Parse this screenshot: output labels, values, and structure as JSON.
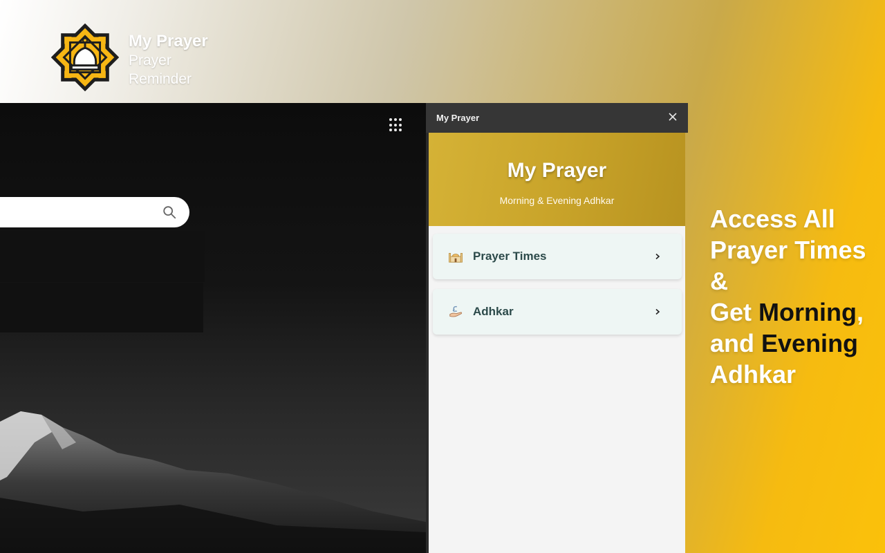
{
  "brand": {
    "title": "My Prayer",
    "subtitle_line1": "Prayer",
    "subtitle_line2": "Reminder",
    "logo_icon": "mosque-star-icon"
  },
  "browser": {
    "apps_icon": "apps-grid-icon",
    "search_icon": "search-icon",
    "search_placeholder": ""
  },
  "panel": {
    "bar_title": "My Prayer",
    "close_icon": "close-icon",
    "hero_title": "My Prayer",
    "hero_subtitle": "Morning & Evening Adhkar",
    "items": [
      {
        "label": "Prayer Times",
        "icon": "mosque-icon"
      },
      {
        "label": "Adhkar",
        "icon": "praying-hand-icon"
      }
    ]
  },
  "tagline": {
    "line1": "Access All",
    "line2": "Prayer Times",
    "line3": "&",
    "line4_a": "Get ",
    "line4_b": "Morning",
    "line4_c": ",",
    "line5_a": "and ",
    "line5_b": "Evening",
    "line6": "Adhkar"
  },
  "colors": {
    "accent_gold": "#c9a42a",
    "bright_yellow": "#fbc10a",
    "panel_bar": "#363636",
    "card_bg": "#eef6f4",
    "card_text": "#2c4a4a"
  }
}
